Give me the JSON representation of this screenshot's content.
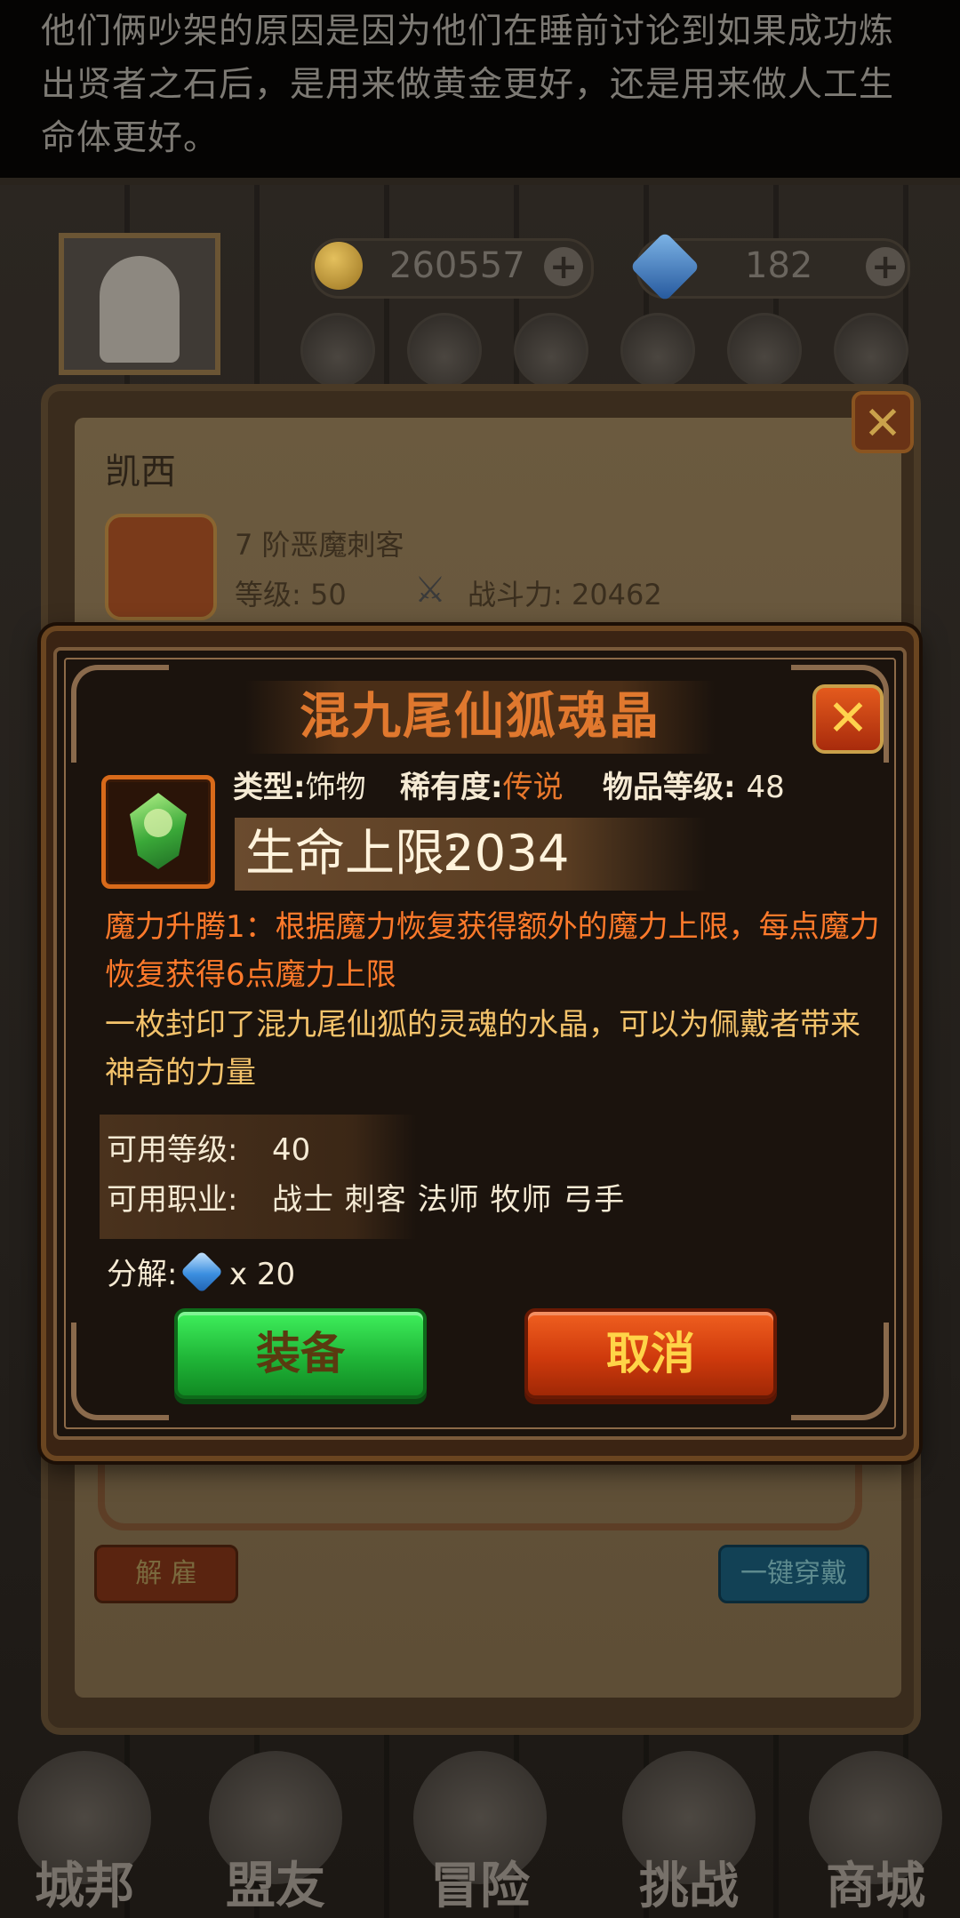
{
  "hint": {
    "text": "他们俩吵架的原因是因为他们在睡前讨论到如果成功炼出贤者之石后，是用来做黄金更好，还是用来做人工生命体更好。"
  },
  "resources": {
    "gold": "260557",
    "gems": "182",
    "gold_icon": "gold-coin-icon",
    "gem_icon": "blue-gem-icon"
  },
  "hero": {
    "name": "凯西",
    "class": "7 阶恶魔刺客",
    "level_text": "等级: 50",
    "power_text": "战斗力:  20462",
    "stars": "★★★★★",
    "dismiss_label": "解 雇",
    "equip_all_label": "一键穿戴"
  },
  "item_dialog": {
    "title": "混九尾仙狐魂晶",
    "close_glyph": "✕",
    "type_label": "类型:",
    "type_value": "饰物",
    "rarity_label": "稀有度:",
    "rarity_value": "传说",
    "item_level_label": "物品等级:",
    "item_level_value": "48",
    "stat_label": "生命上限:",
    "stat_value": "2034",
    "skill_text": "魔力升腾1：根据魔力恢复获得额外的魔力上限，每点魔力恢复获得6点魔力上限",
    "description": "一枚封印了混九尾仙狐的灵魂的水晶，可以为佩戴者带来神奇的力量",
    "req_level_label": "可用等级:",
    "req_level_value": "40",
    "req_class_label": "可用职业:",
    "req_class_value": "战士 刺客 法师 牧师 弓手",
    "decompose_label": "分解:",
    "decompose_qty": "x 20",
    "equip_label": "装备",
    "cancel_label": "取消"
  },
  "bottom_nav": [
    {
      "label": "城邦"
    },
    {
      "label": "盟友"
    },
    {
      "label": "冒险"
    },
    {
      "label": "挑战"
    },
    {
      "label": "商城"
    }
  ],
  "colors": {
    "title_orange": "#e0782e",
    "rarity_legendary": "#e8782c",
    "skill_orange": "#ff7a2b",
    "desc_gold": "#f4c36b",
    "equip_green": "#20b638",
    "cancel_red": "#cf3a0c"
  }
}
